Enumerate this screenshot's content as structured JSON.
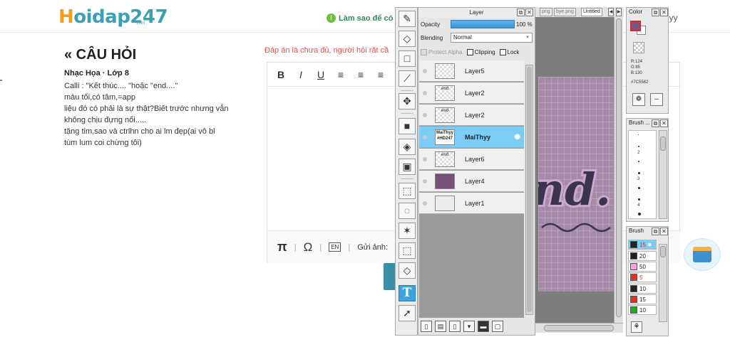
{
  "site": {
    "logo_text": "oidap247",
    "logo_h": "H",
    "logo_sub": ".com",
    "notice": "Làm sao để có",
    "user_partial": "hyy"
  },
  "question": {
    "back_title": "« CÂU HỎI",
    "subject": "Nhạc Họa · Lớp 8",
    "lines": [
      "Calli : \"Kết thúc.... \"hoặc \"end....\"",
      "màu tối,có tâm,=app",
      "liệu đó có phải là sự thật?Biết trước nhưng vẫn",
      "không chịu đựng nổi.....",
      "tặng tim,sao và ctrlhn cho ai lm đẹp(ai vô bl",
      "tùm lum coi chừng tôi)"
    ]
  },
  "answer": {
    "error_msg": "Đáp án là chưa đủ, người hỏi rất cầ",
    "toolbar": [
      "B",
      "I",
      "U",
      "≡",
      "≡",
      "≡",
      "≡"
    ],
    "foot_pi": "π",
    "foot_omega": "Ω",
    "foot_en": "EN",
    "foot_send": "Gửi ảnh:"
  },
  "tools": {
    "text_tool": "T"
  },
  "layer_panel": {
    "title": "Layer",
    "opacity_label": "Opacity",
    "opacity_value": "100 %",
    "opacity_fraction": 1.0,
    "blending_label": "Blending",
    "blending_value": "Normal",
    "protect_alpha": "Protect Alpha",
    "clipping": "Clipping",
    "lock": "Lock",
    "layers": [
      {
        "name": "Layer5",
        "thumb": "",
        "selected": false
      },
      {
        "name": "Layer2",
        "thumb": "end",
        "selected": false
      },
      {
        "name": "Layer2",
        "thumb": "end",
        "selected": false
      },
      {
        "name": "MaiThyy",
        "thumb": "MaiThyy #HD247",
        "selected": true
      },
      {
        "name": "Layer6",
        "thumb": "end",
        "selected": false
      },
      {
        "name": "Layer4",
        "thumb": "",
        "selected": false
      },
      {
        "name": "Layer1",
        "thumb": "",
        "selected": false
      }
    ]
  },
  "tabs": [
    {
      "label": "png",
      "active": false
    },
    {
      "label": "bye.png",
      "active": false
    },
    {
      "label": "Untitled",
      "active": true
    }
  ],
  "canvas_text": "nd.",
  "color_panel": {
    "title": "Color",
    "r": "R:124",
    "g": "G:85",
    "b": "B:130",
    "hex": "#7C5582",
    "color": "#7C5582"
  },
  "brush_size_panel": {
    "title": "Brush ...",
    "sizes": [
      "2",
      "3",
      "4"
    ]
  },
  "brush_panel": {
    "title": "Brush",
    "items": [
      {
        "value": "15",
        "color": "#222222",
        "selected": true
      },
      {
        "value": "20",
        "color": "#222222",
        "selected": false
      },
      {
        "value": "50",
        "color": "#f4a6e0",
        "selected": false
      },
      {
        "value": "5",
        "color": "#e03030",
        "selected": false
      },
      {
        "value": "10",
        "color": "#222222",
        "selected": false
      },
      {
        "value": "15",
        "color": "#e03030",
        "selected": false
      },
      {
        "value": "10",
        "color": "#22aa22",
        "selected": false
      }
    ]
  }
}
